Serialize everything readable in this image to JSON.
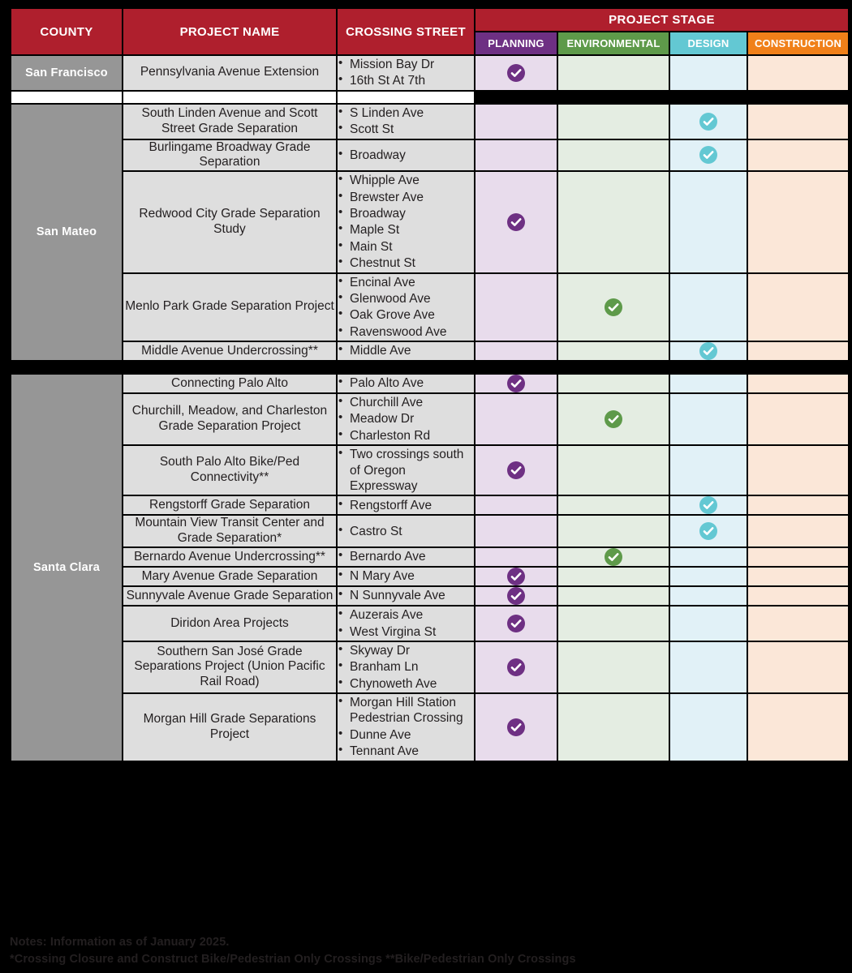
{
  "table": {
    "headers": {
      "county": "COUNTY",
      "project_name": "PROJECT NAME",
      "crossing_street": "CROSSING STREET",
      "project_stage": "PROJECT STAGE",
      "stages": [
        {
          "label": "PLANNING",
          "key": "planning",
          "color": "#6E3083",
          "tint": "#E8DCEC"
        },
        {
          "label": "ENVIRONMENTAL",
          "key": "environmental",
          "color": "#5E9A4A",
          "tint": "#E4EDE2"
        },
        {
          "label": "DESIGN",
          "key": "design",
          "color": "#63C8D3",
          "tint": "#E1F1F7"
        },
        {
          "label": "CONSTRUCTION",
          "key": "construction",
          "color": "#F08019",
          "tint": "#FBE7D8"
        }
      ]
    },
    "header_color": "#AF1F2D",
    "county_color": "#969696",
    "row_color": "#DEDEDE",
    "groups": [
      {
        "county": "San Francisco",
        "rows": [
          {
            "project": "Pennsylvania Avenue Extension",
            "crossings": [
              "Mission Bay Dr",
              "16th St At 7th"
            ],
            "stage": "planning"
          }
        ]
      },
      {
        "county": "San Mateo",
        "rows": [
          {
            "project": "South Linden Avenue and Scott Street Grade Separation",
            "crossings": [
              "S Linden Ave",
              "Scott St"
            ],
            "stage": "design"
          },
          {
            "project": "Burlingame Broadway Grade Separation",
            "crossings": [
              "Broadway"
            ],
            "stage": "design"
          },
          {
            "project": "Redwood City Grade Separation Study",
            "crossings": [
              "Whipple Ave",
              "Brewster Ave",
              "Broadway",
              "Maple St",
              "Main St",
              "Chestnut St"
            ],
            "stage": "planning"
          },
          {
            "project": "Menlo Park Grade Separation Project",
            "crossings": [
              "Encinal Ave",
              "Glenwood Ave",
              "Oak Grove Ave",
              "Ravenswood Ave"
            ],
            "stage": "environmental"
          },
          {
            "project": "Middle Avenue Undercrossing**",
            "crossings": [
              "Middle Ave"
            ],
            "stage": "design"
          }
        ]
      },
      {
        "county": "Santa Clara",
        "rows": [
          {
            "project": "Connecting Palo Alto",
            "crossings": [
              "Palo Alto Ave"
            ],
            "stage": "planning"
          },
          {
            "project": "Churchill, Meadow, and Charleston Grade Separation Project",
            "crossings": [
              "Churchill Ave",
              "Meadow Dr",
              "Charleston Rd"
            ],
            "stage": "environmental"
          },
          {
            "project": "South Palo Alto Bike/Ped Connectivity**",
            "crossings": [
              "Two crossings south of Oregon Expressway"
            ],
            "stage": "planning"
          },
          {
            "project": "Rengstorff Grade Separation",
            "crossings": [
              "Rengstorff Ave"
            ],
            "stage": "design"
          },
          {
            "project": "Mountain View Transit Center and Grade Separation*",
            "crossings": [
              "Castro St"
            ],
            "stage": "design"
          },
          {
            "project": "Bernardo Avenue Undercrossing**",
            "crossings": [
              "Bernardo Ave"
            ],
            "stage": "environmental"
          },
          {
            "project": "Mary Avenue Grade Separation",
            "crossings": [
              "N Mary Ave"
            ],
            "stage": "planning"
          },
          {
            "project": "Sunnyvale Avenue Grade Separation",
            "crossings": [
              "N Sunnyvale Ave"
            ],
            "stage": "planning"
          },
          {
            "project": "Diridon Area Projects",
            "crossings": [
              "Auzerais Ave",
              "West Virgina St"
            ],
            "stage": "planning"
          },
          {
            "project": "Southern San José Grade Separations Project (Union Pacific Rail Road)",
            "crossings": [
              "Skyway Dr",
              "Branham Ln",
              "Chynoweth Ave"
            ],
            "stage": "planning"
          },
          {
            "project": "Morgan Hill Grade Separations Project",
            "crossings": [
              "Morgan Hill Station Pedestrian Crossing",
              "Dunne Ave",
              "Tennant Ave"
            ],
            "stage": "planning"
          }
        ]
      }
    ]
  },
  "notes": [
    "Notes: Information as of January 2025.",
    "*Crossing Closure and Construct Bike/Pedestrian Only Crossings  **Bike/Pedestrian Only Crossings"
  ]
}
